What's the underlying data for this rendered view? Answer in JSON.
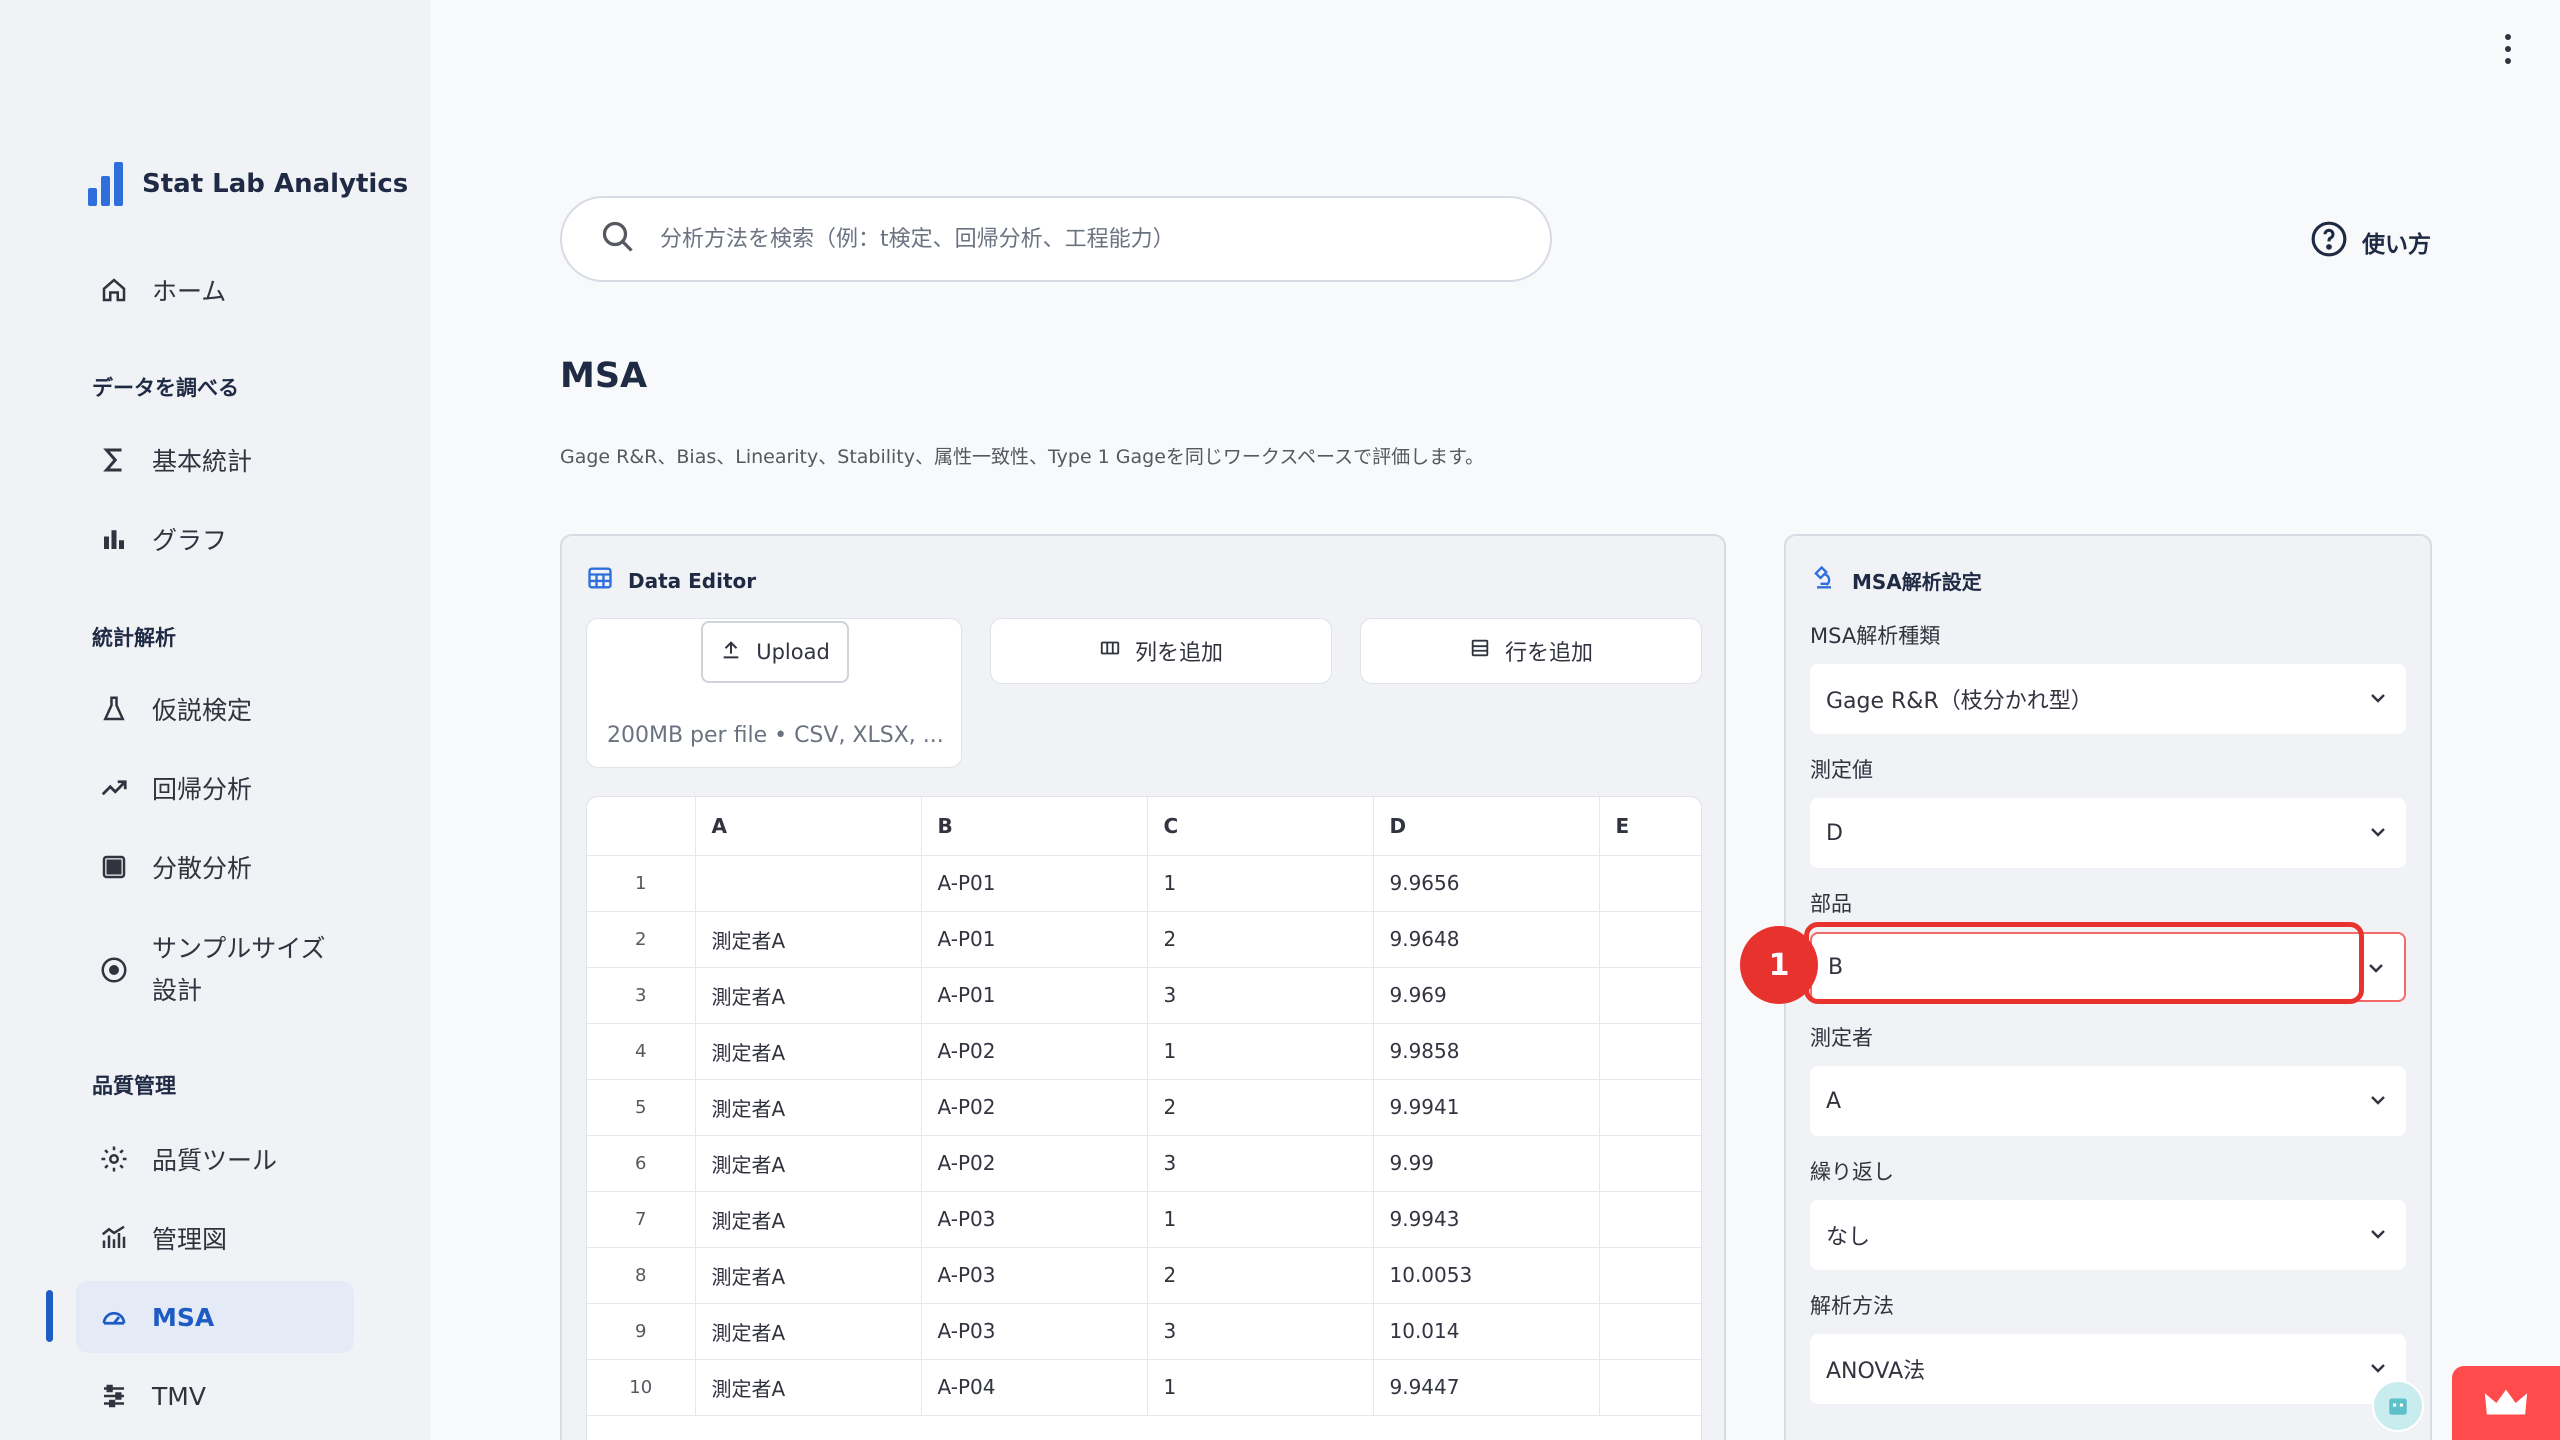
{
  "app": {
    "name": "Stat Lab Analytics"
  },
  "sidebar": {
    "items": [
      {
        "label": "ホーム"
      },
      {
        "label": "基本統計"
      },
      {
        "label": "グラフ"
      },
      {
        "label": "仮説検定"
      },
      {
        "label": "回帰分析"
      },
      {
        "label": "分散分析"
      },
      {
        "label": "サンプルサイズ"
      },
      {
        "label": "設計"
      },
      {
        "label": "品質ツール"
      },
      {
        "label": "管理図"
      },
      {
        "label": "MSA"
      },
      {
        "label": "TMV"
      }
    ],
    "sections": [
      "データを調べる",
      "統計解析",
      "品質管理"
    ]
  },
  "search": {
    "placeholder": "分析方法を検索（例：t検定、回帰分析、工程能力）"
  },
  "help": {
    "label": "使い方"
  },
  "page": {
    "title": "MSA",
    "description": "Gage R&R、Bias、Linearity、Stability、属性一致性、Type 1 Gageを同じワークスペースで評価します。"
  },
  "editor": {
    "title": "Data Editor",
    "upload_label": "Upload",
    "upload_hint": "200MB per file • CSV, XLSX, ...",
    "add_column": "列を追加",
    "add_row": "行を追加",
    "columns": [
      "",
      "A",
      "B",
      "C",
      "D",
      "E"
    ],
    "rows": [
      [
        "1",
        "",
        "A-P01",
        "1",
        "9.9656",
        ""
      ],
      [
        "2",
        "測定者A",
        "A-P01",
        "2",
        "9.9648",
        ""
      ],
      [
        "3",
        "測定者A",
        "A-P01",
        "3",
        "9.969",
        ""
      ],
      [
        "4",
        "測定者A",
        "A-P02",
        "1",
        "9.9858",
        ""
      ],
      [
        "5",
        "測定者A",
        "A-P02",
        "2",
        "9.9941",
        ""
      ],
      [
        "6",
        "測定者A",
        "A-P02",
        "3",
        "9.99",
        ""
      ],
      [
        "7",
        "測定者A",
        "A-P03",
        "1",
        "9.9943",
        ""
      ],
      [
        "8",
        "測定者A",
        "A-P03",
        "2",
        "10.0053",
        ""
      ],
      [
        "9",
        "測定者A",
        "A-P03",
        "3",
        "10.014",
        ""
      ],
      [
        "10",
        "測定者A",
        "A-P04",
        "1",
        "9.9447",
        ""
      ]
    ]
  },
  "settings": {
    "title": "MSA解析設定",
    "fields": [
      {
        "label": "MSA解析種類",
        "value": "Gage R&R（枝分かれ型）"
      },
      {
        "label": "測定値",
        "value": "D"
      },
      {
        "label": "部品",
        "value": "B"
      },
      {
        "label": "測定者",
        "value": "A"
      },
      {
        "label": "繰り返し",
        "value": "なし"
      },
      {
        "label": "解析方法",
        "value": "ANOVA法"
      }
    ]
  },
  "annotation": {
    "badge": "1"
  },
  "colors": {
    "accent": "#1d5cc4",
    "highlight": "#e8322d",
    "fab": "#ff4b4b"
  }
}
